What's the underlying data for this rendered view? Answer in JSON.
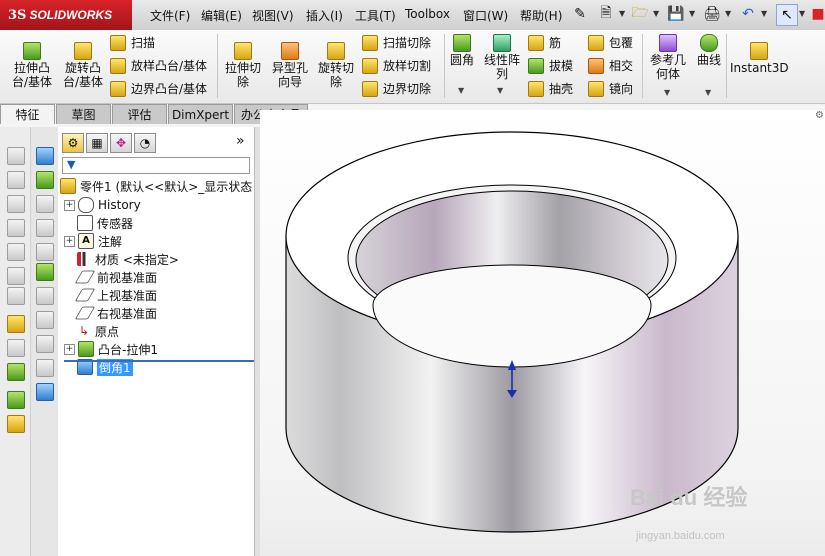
{
  "app": {
    "logo_ds": "3S",
    "logo_name": "SOLIDWORKS"
  },
  "menu": [
    "文件(F)",
    "编辑(E)",
    "视图(V)",
    "插入(I)",
    "工具(T)",
    "Toolbox",
    "窗口(W)",
    "帮助(H)"
  ],
  "ribbon": {
    "extrude_boss": "拉伸凸\n台/基体",
    "revolve_boss": "旋转凸\n台/基体",
    "sweep": "扫描",
    "loft_boss": "放样凸台/基体",
    "boundary_boss": "边界凸台/基体",
    "extrude_cut": "拉伸切\n除",
    "hole_wizard": "异型孔\n向导",
    "revolve_cut": "旋转切\n除",
    "swept_cut": "扫描切除",
    "lofted_cut": "放样切割",
    "boundary_cut": "边界切除",
    "fillet": "圆角",
    "linear_pattern": "线性阵\n列",
    "rib": "筋",
    "draft": "拔模",
    "shell": "抽壳",
    "wrap": "包覆",
    "intersect": "相交",
    "mirror": "镜向",
    "ref_geometry": "参考几\n何体",
    "curves": "曲线",
    "instant3d": "Instant3D"
  },
  "tabs": [
    "特征",
    "草图",
    "评估",
    "DimXpert",
    "办公室产品"
  ],
  "tree": {
    "part": "零件1  (默认<<默认>_显示状态",
    "items": [
      "History",
      "传感器",
      "注解",
      "材质 <未指定>",
      "前视基准面",
      "上视基准面",
      "右视基准面",
      "原点",
      "凸台-拉伸1",
      "倒角1"
    ]
  },
  "watermark": {
    "main": "Bai du 经验",
    "sub": "jingyan.baidu.com"
  }
}
